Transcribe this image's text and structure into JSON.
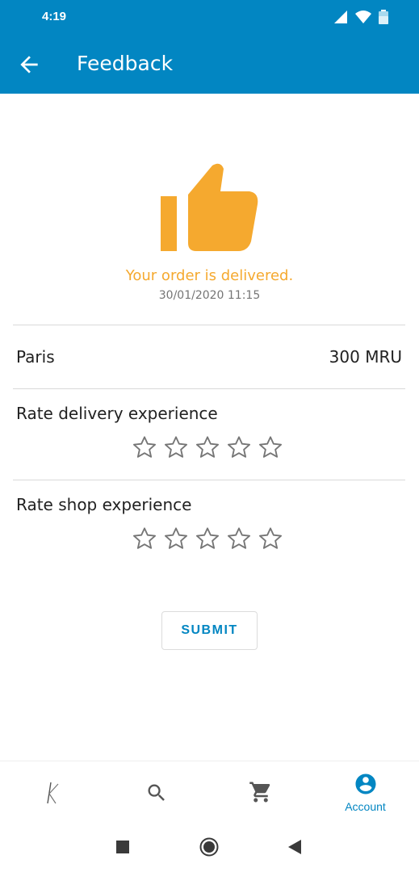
{
  "status_bar": {
    "time": "4:19",
    "icons": [
      "signal-icon",
      "wifi-icon",
      "battery-icon"
    ]
  },
  "header": {
    "title": "Feedback",
    "back_icon": "arrow-back-icon"
  },
  "order": {
    "icon": "thumbs-up-icon",
    "status_text": "Your order is delivered.",
    "date": "30/01/2020 11:15",
    "city": "Paris",
    "price": "300 MRU"
  },
  "ratings": [
    {
      "label": "Rate delivery experience",
      "value": 0,
      "max": 5
    },
    {
      "label": "Rate shop experience",
      "value": 0,
      "max": 5
    }
  ],
  "submit_label": "SUBMIT",
  "bottom_nav": {
    "items": [
      {
        "icon": "brand-logo-icon",
        "label": ""
      },
      {
        "icon": "search-icon",
        "label": ""
      },
      {
        "icon": "cart-icon",
        "label": ""
      },
      {
        "icon": "account-icon",
        "label": "Account",
        "active": true
      }
    ]
  },
  "system_nav": [
    "recents-icon",
    "home-icon",
    "back-icon"
  ],
  "colors": {
    "primary": "#0286c2",
    "accent": "#f5a92f",
    "star_outline": "#757575"
  }
}
